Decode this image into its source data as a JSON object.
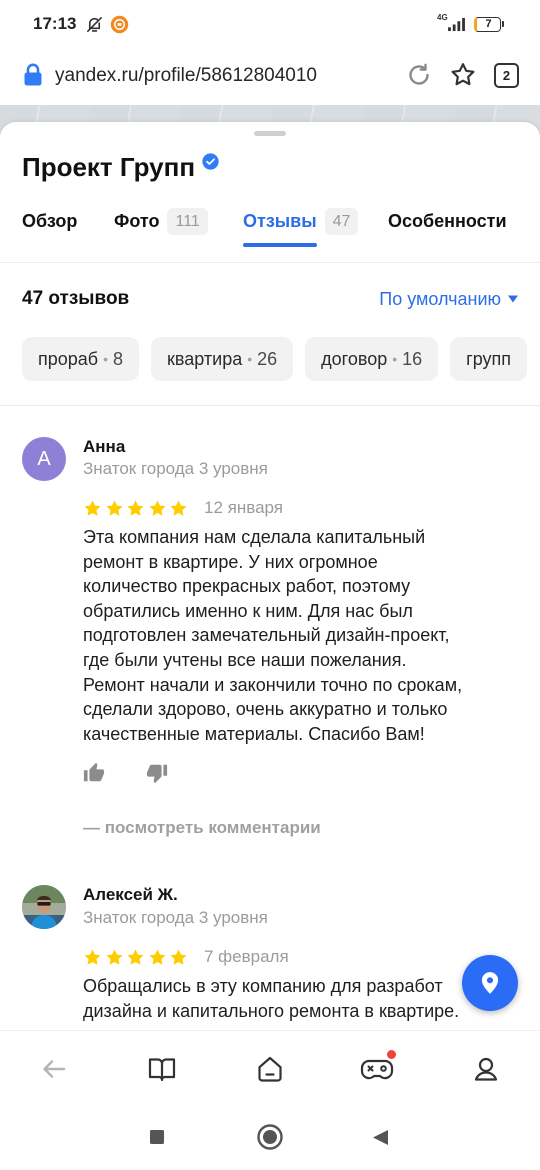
{
  "status_bar": {
    "time": "17:13",
    "network": "4G",
    "battery": "7",
    "icons": [
      "notifications-off-icon",
      "app-notification-icon",
      "signal-icon",
      "battery-icon"
    ]
  },
  "url_bar": {
    "url": "yandex.ru/profile/58612804010",
    "tab_count": "2",
    "icons": [
      "lock-icon",
      "reload-icon",
      "bookmark-star-icon"
    ]
  },
  "business": {
    "name": "Проект Групп",
    "verified": true
  },
  "tabs": [
    {
      "label": "Обзор"
    },
    {
      "label": "Фото",
      "count": "111"
    },
    {
      "label": "Отзывы",
      "count": "47",
      "active": true
    },
    {
      "label": "Особенности"
    }
  ],
  "reviews_header": {
    "count_label": "47 отзывов",
    "sort_label": "По умолчанию"
  },
  "chip_separator": "•",
  "chips": [
    {
      "label": "прораб",
      "count": "8"
    },
    {
      "label": "квартира",
      "count": "26"
    },
    {
      "label": "договор",
      "count": "16"
    },
    {
      "label": "групп"
    }
  ],
  "reviews": [
    {
      "author": "Анна",
      "avatar_letter": "А",
      "level": "Знаток города 3 уровня",
      "rating": 5,
      "date": "12 января",
      "text_lines": [
        "Эта компания нам сделала капитальный",
        "ремонт в квартире. У них огромное",
        "количество прекрасных работ, поэтому",
        "обратились именно к ним. Для нас был",
        "подготовлен замечательный дизайн-проект,",
        "где были учтены все наши пожелания.",
        "Ремонт начали и закончили точно по срокам,",
        "сделали здорово, очень аккуратно и только",
        "качественные материалы. Спасибо Вам!"
      ],
      "comments_link": "— посмотреть комментарии"
    },
    {
      "author": "Алексей Ж.",
      "level": "Знаток города 3 уровня",
      "rating": 5,
      "date": "7 февраля",
      "text_lines": [
        "Обращались в эту компанию для разработ",
        "дизайна и капитального ремонта в квартире."
      ]
    }
  ],
  "bottom_toolbar": [
    {
      "icon": "back-arrow-icon",
      "enabled": false
    },
    {
      "icon": "book-icon"
    },
    {
      "icon": "home-icon"
    },
    {
      "icon": "games-icon",
      "has_notification_dot": true
    },
    {
      "icon": "profile-icon"
    }
  ],
  "android_nav": [
    {
      "icon": "recents-square-icon"
    },
    {
      "icon": "home-circle-icon"
    },
    {
      "icon": "back-triangle-icon"
    }
  ],
  "colors": {
    "accent": "#2d6ee8",
    "star": "#ffcc00",
    "fab": "#2a6cf6",
    "avatar_anna": "#8e80d6",
    "notification_dot": "#f04438",
    "lock": "#2f7cf6"
  }
}
